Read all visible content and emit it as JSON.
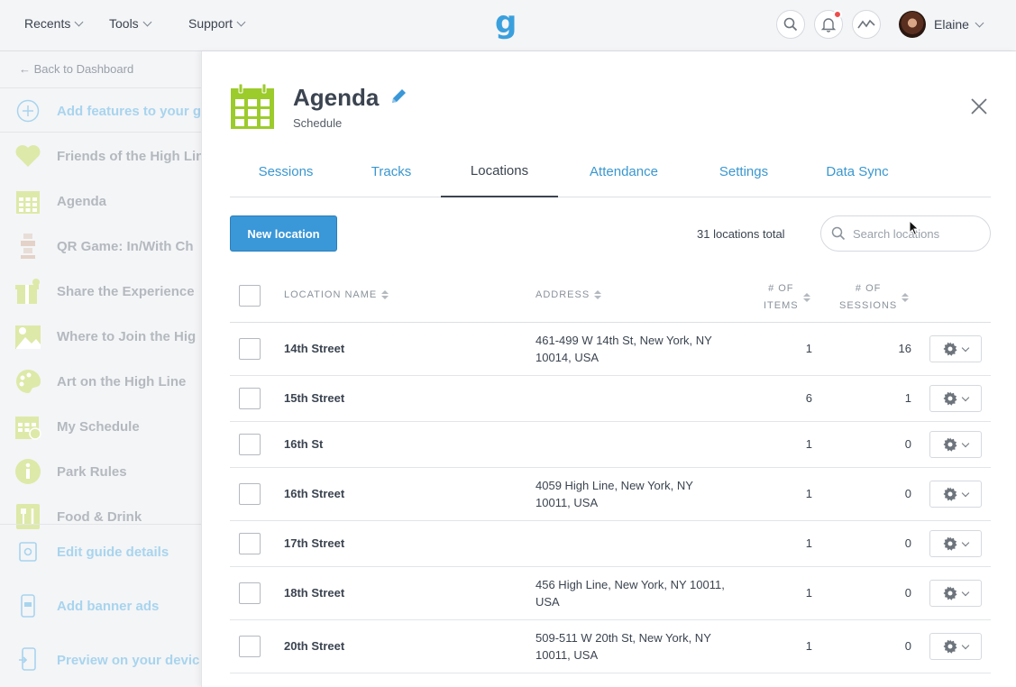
{
  "topnav": {
    "recents": "Recents",
    "tools": "Tools",
    "support": "Support",
    "logo": "g",
    "user": "Elaine"
  },
  "sidebar": {
    "back": "← Back to Dashboard",
    "add_features": "Add features to your g",
    "items": [
      {
        "label": "Friends of the High Line",
        "icon": "heart-icon"
      },
      {
        "label": "Agenda",
        "icon": "calendar-icon"
      },
      {
        "label": "QR Game: In/With Ch",
        "icon": "qr-icon"
      },
      {
        "label": "Share the Experience",
        "icon": "gift-icon"
      },
      {
        "label": "Where to Join the Hig",
        "icon": "map-pin-icon"
      },
      {
        "label": "Art on the High Line",
        "icon": "palette-icon"
      },
      {
        "label": "My Schedule",
        "icon": "calendar-check-icon"
      },
      {
        "label": "Park Rules",
        "icon": "info-icon"
      },
      {
        "label": "Food & Drink",
        "icon": "utensils-icon"
      }
    ],
    "bottom": [
      {
        "label": "Edit guide details",
        "icon": "settings-icon"
      },
      {
        "label": "Add banner ads",
        "icon": "phone-icon"
      },
      {
        "label": "Preview on your devic",
        "icon": "device-preview-icon"
      }
    ]
  },
  "panel": {
    "title": "Agenda",
    "subtitle": "Schedule",
    "tabs": [
      "Sessions",
      "Tracks",
      "Locations",
      "Attendance",
      "Settings",
      "Data Sync"
    ],
    "active_tab": "Locations",
    "new_button": "New location",
    "total": "31 locations total",
    "search_placeholder": "Search locations",
    "columns": {
      "name": "LOCATION NAME",
      "address": "ADDRESS",
      "items_1": "# OF",
      "items_2": "ITEMS",
      "sessions_1": "# OF",
      "sessions_2": "SESSIONS"
    },
    "rows": [
      {
        "name": "14th Street",
        "address_1": "461-499 W 14th St, New York, NY",
        "address_2": "10014, USA",
        "items": "1",
        "sessions": "16"
      },
      {
        "name": "15th Street",
        "address_1": "",
        "address_2": "",
        "items": "6",
        "sessions": "1"
      },
      {
        "name": "16th St",
        "address_1": "",
        "address_2": "",
        "items": "1",
        "sessions": "0"
      },
      {
        "name": "16th Street",
        "address_1": "4059 High Line, New York, NY",
        "address_2": "10011, USA",
        "items": "1",
        "sessions": "0"
      },
      {
        "name": "17th Street",
        "address_1": "",
        "address_2": "",
        "items": "1",
        "sessions": "0"
      },
      {
        "name": "18th Street",
        "address_1": "456 High Line, New York, NY 10011,",
        "address_2": "USA",
        "items": "1",
        "sessions": "0"
      },
      {
        "name": "20th Street",
        "address_1": "509-511 W 20th St, New York, NY",
        "address_2": "10011, USA",
        "items": "1",
        "sessions": "0"
      }
    ]
  },
  "colors": {
    "accent_blue": "#3a97cf",
    "button_blue": "#3a97d8",
    "feature_green": "#9ccb2c",
    "notification_red": "#ee4d4d"
  }
}
